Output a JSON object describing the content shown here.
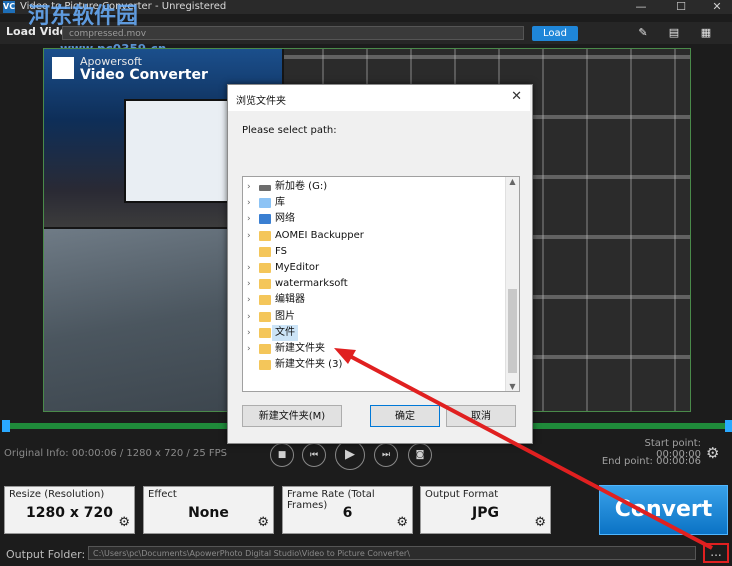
{
  "window": {
    "title": "Video to Picture Converter - Unregistered",
    "app_icon": "VC",
    "minimize": "—",
    "maximize": "☐",
    "close": "✕"
  },
  "watermark": {
    "text1": "河东软件园",
    "text2": "www.pc0359.cn"
  },
  "load": {
    "label": "Load Video:",
    "path": "compressed.mov",
    "button": "Load",
    "icons": [
      "tag-icon",
      "chat-icon",
      "document-icon"
    ]
  },
  "preview": {
    "logo_line1": "Apowersoft",
    "logo_line2": "Video Converter"
  },
  "info": {
    "original": "Original Info: 00:00:06 / 1280 x 720 / 25 FPS",
    "start_point": "Start point: 00:00:00",
    "end_point": "End point: 00:00:06"
  },
  "controls": {
    "stop": "■",
    "prev": "⏮",
    "play": "▶",
    "next": "⏭",
    "snapshot": "◙"
  },
  "settings": [
    {
      "caption": "Resize (Resolution)",
      "value": "1280 x 720"
    },
    {
      "caption": "Effect",
      "value": "None"
    },
    {
      "caption": "Frame Rate (Total Frames)",
      "value": "6"
    },
    {
      "caption": "Output Format",
      "value": "JPG"
    }
  ],
  "convert": "Convert",
  "output": {
    "label": "Output Folder:",
    "path": "C:\\Users\\pc\\Documents\\ApowerPhoto Digital Studio\\Video to Picture Converter\\",
    "browse": "..."
  },
  "dialog": {
    "title": "浏览文件夹",
    "close": "✕",
    "prompt": "Please select path:",
    "tree": [
      {
        "label": "新加卷 (G:)",
        "type": "drive",
        "chevron": "›"
      },
      {
        "label": "库",
        "type": "lib",
        "chevron": "›"
      },
      {
        "label": "网络",
        "type": "net",
        "chevron": "›"
      },
      {
        "label": "AOMEI Backupper",
        "type": "folder",
        "chevron": "›"
      },
      {
        "label": "FS",
        "type": "folder",
        "chevron": ""
      },
      {
        "label": "MyEditor",
        "type": "folder",
        "chevron": "›"
      },
      {
        "label": "watermarksoft",
        "type": "folder",
        "chevron": "›"
      },
      {
        "label": "编辑器",
        "type": "folder",
        "chevron": "›"
      },
      {
        "label": "图片",
        "type": "folder",
        "chevron": "›"
      },
      {
        "label": "文件",
        "type": "folder",
        "chevron": "›",
        "selected": true
      },
      {
        "label": "新建文件夹",
        "type": "folder",
        "chevron": "›"
      },
      {
        "label": "新建文件夹 (3)",
        "type": "folder",
        "chevron": ""
      }
    ],
    "new_folder": "新建文件夹(M)",
    "ok": "确定",
    "cancel": "取消"
  },
  "colors": {
    "accent": "#1f86d8",
    "highlight": "#e02020",
    "timeline": "#1f8a3a"
  }
}
